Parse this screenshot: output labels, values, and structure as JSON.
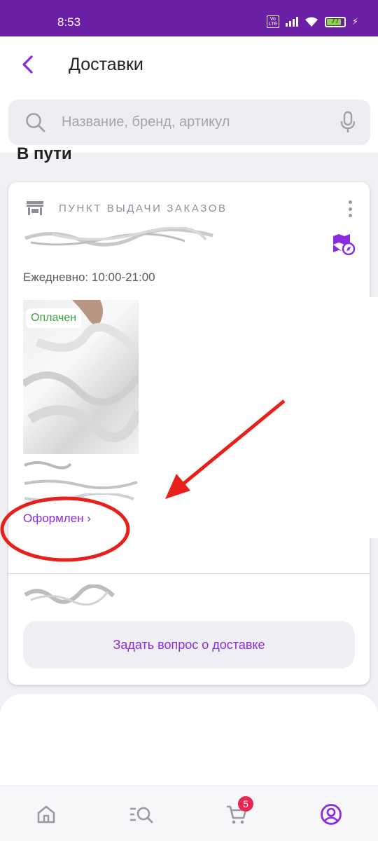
{
  "status_bar": {
    "time": "8:53",
    "volte": "Vo LTE",
    "battery": "77"
  },
  "header": {
    "title": "Доставки"
  },
  "search": {
    "placeholder": "Название, бренд, артикул"
  },
  "section": {
    "title": "В пути"
  },
  "card": {
    "pickup_label": "ПУНКТ ВЫДАЧИ ЗАКАЗОВ",
    "schedule": "Ежедневно: 10:00-21:00",
    "paid_badge": "Оплачен",
    "status_link": "Оформлен ›",
    "ask_button": "Задать вопрос о доставке"
  },
  "nav": {
    "cart_count": "5"
  },
  "colors": {
    "accent": "#8a2be2",
    "status_bar": "#6a1fa5",
    "paid": "#3ea142",
    "annotation": "#e8201c",
    "badge": "#e8264f"
  },
  "icons": [
    "back-icon",
    "search-icon",
    "mic-icon",
    "store-icon",
    "more-vert-icon",
    "map-icon",
    "home-icon",
    "catalog-icon",
    "cart-icon",
    "profile-icon"
  ]
}
